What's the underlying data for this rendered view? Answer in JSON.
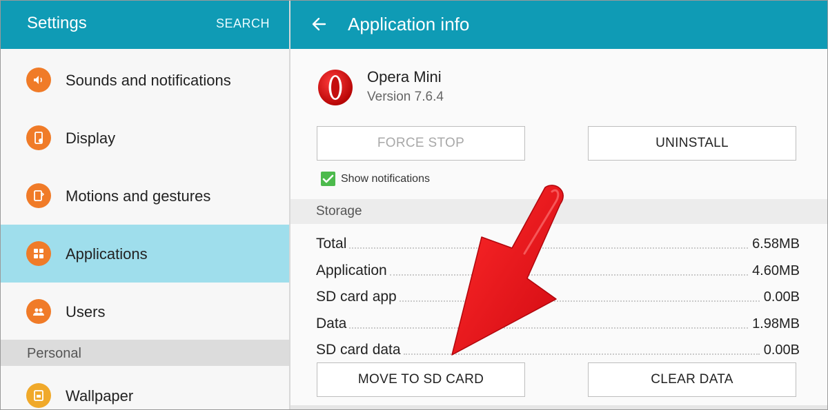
{
  "left_pane": {
    "title": "Settings",
    "search_label": "SEARCH",
    "items": [
      {
        "label": "Sounds and notifications",
        "icon": "speaker-icon"
      },
      {
        "label": "Display",
        "icon": "display-icon"
      },
      {
        "label": "Motions and gestures",
        "icon": "motion-icon"
      },
      {
        "label": "Applications",
        "icon": "apps-grid-icon",
        "selected": true
      },
      {
        "label": "Users",
        "icon": "users-icon"
      }
    ],
    "section_personal": "Personal",
    "personal_items": [
      {
        "label": "Wallpaper",
        "icon": "wallpaper-icon"
      }
    ]
  },
  "right_pane": {
    "title": "Application info",
    "app": {
      "name": "Opera Mini",
      "version": "Version 7.6.4",
      "icon": "opera-logo-icon"
    },
    "buttons": {
      "force_stop": "FORCE STOP",
      "uninstall": "UNINSTALL",
      "move_to_sd": "MOVE TO SD CARD",
      "clear_data": "CLEAR DATA"
    },
    "show_notifications": {
      "label": "Show notifications",
      "checked": true
    },
    "storage": {
      "header": "Storage",
      "rows": [
        {
          "label": "Total",
          "value": "6.58MB"
        },
        {
          "label": "Application",
          "value": "4.60MB"
        },
        {
          "label": "SD card app",
          "value": "0.00B"
        },
        {
          "label": "Data",
          "value": "1.98MB"
        },
        {
          "label": "SD card data",
          "value": "0.00B"
        }
      ]
    }
  },
  "colors": {
    "header_blue": "#0f9bb5",
    "selected_bg": "#9fdeec",
    "icon_orange": "#f07b28",
    "checkbox_green": "#4cba4c",
    "arrow_red": "#e5141b"
  }
}
